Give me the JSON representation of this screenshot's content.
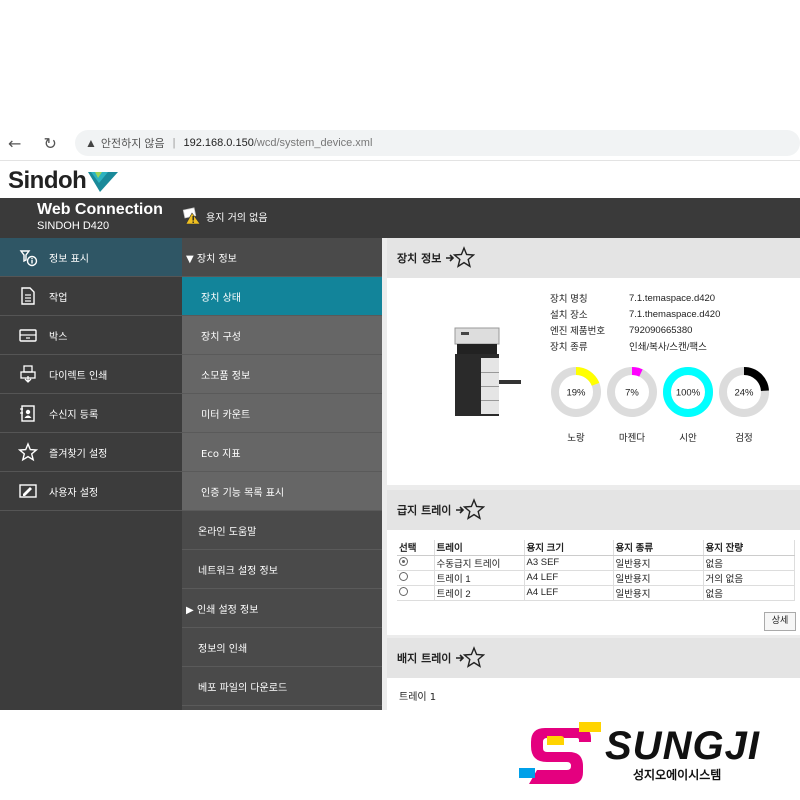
{
  "browser": {
    "back_icon": "back-arrow-icon",
    "refresh_icon": "refresh-icon",
    "insecure_label": "안전하지 않음",
    "url_host": "192.168.0.150",
    "url_path": "/wcd/system_device.xml"
  },
  "brand": {
    "logo_text": "Sindoh",
    "product_title": "Web Connection",
    "model": "SINDOH D420",
    "alert_text": "용지 거의 없음",
    "accent_color": "#12849a"
  },
  "sidebar": {
    "items": [
      {
        "label": "정보 표시",
        "icon": "info-display-icon"
      },
      {
        "label": "작업",
        "icon": "document-icon"
      },
      {
        "label": "박스",
        "icon": "box-icon"
      },
      {
        "label": "다이렉트 인쇄",
        "icon": "direct-print-icon"
      },
      {
        "label": "수신지 등록",
        "icon": "address-book-icon"
      },
      {
        "label": "즐겨찾기 설정",
        "icon": "star-icon"
      },
      {
        "label": "사용자 설정",
        "icon": "user-settings-icon"
      }
    ]
  },
  "submenu": {
    "items": [
      {
        "label": "▼ 장치 정보"
      },
      {
        "label": "장치 상태"
      },
      {
        "label": "장치 구성"
      },
      {
        "label": "소모품 정보"
      },
      {
        "label": "미터 카운트"
      },
      {
        "label": "Eco 지표"
      },
      {
        "label": "인증 기능 목록 표시"
      },
      {
        "label": "온라인 도움말"
      },
      {
        "label": "네트워크 설정 정보"
      },
      {
        "label": "▶ 인쇄 설정 정보"
      },
      {
        "label": "정보의 인쇄"
      },
      {
        "label": "베포 파일의 다운로드"
      }
    ]
  },
  "device_info": {
    "title": "장치 정보",
    "rows": [
      {
        "label": "장치 명칭",
        "value": "7.1.temaspace.d420"
      },
      {
        "label": "설치 장소",
        "value": "7.1.themaspace.d420"
      },
      {
        "label": "엔진 제품번호",
        "value": "792090665380"
      },
      {
        "label": "장치 종류",
        "value": "인쇄/복사/스캔/팩스"
      }
    ],
    "toners": [
      {
        "name": "노랑",
        "percent_label": "19%",
        "percent": 19,
        "color": "#ffff00"
      },
      {
        "name": "마젠다",
        "percent_label": "7%",
        "percent": 7,
        "color": "#ff00ff"
      },
      {
        "name": "시안",
        "percent_label": "100%",
        "percent": 100,
        "color": "#00ffff"
      },
      {
        "name": "검정",
        "percent_label": "24%",
        "percent": 24,
        "color": "#000000"
      }
    ]
  },
  "paper_tray": {
    "title": "급지 트레이",
    "headers": [
      "선택",
      "트레이",
      "용지 크기",
      "용지 종류",
      "용지 잔량"
    ],
    "rows": [
      {
        "selected": true,
        "tray": "수동급지 트레이",
        "size": "A3 SEF",
        "type": "일반용지",
        "remaining": "없음"
      },
      {
        "selected": false,
        "tray": "트레이 1",
        "size": "A4 LEF",
        "type": "일반용지",
        "remaining": "거의 없음"
      },
      {
        "selected": false,
        "tray": "트레이 2",
        "size": "A4 LEF",
        "type": "일반용지",
        "remaining": "없음"
      }
    ],
    "detail_label": "상세"
  },
  "output_tray": {
    "title": "배지 트레이",
    "item": "트레이 1"
  },
  "footer_brand": {
    "word": "SUNGJI",
    "korean": "성지오에이시스템"
  }
}
